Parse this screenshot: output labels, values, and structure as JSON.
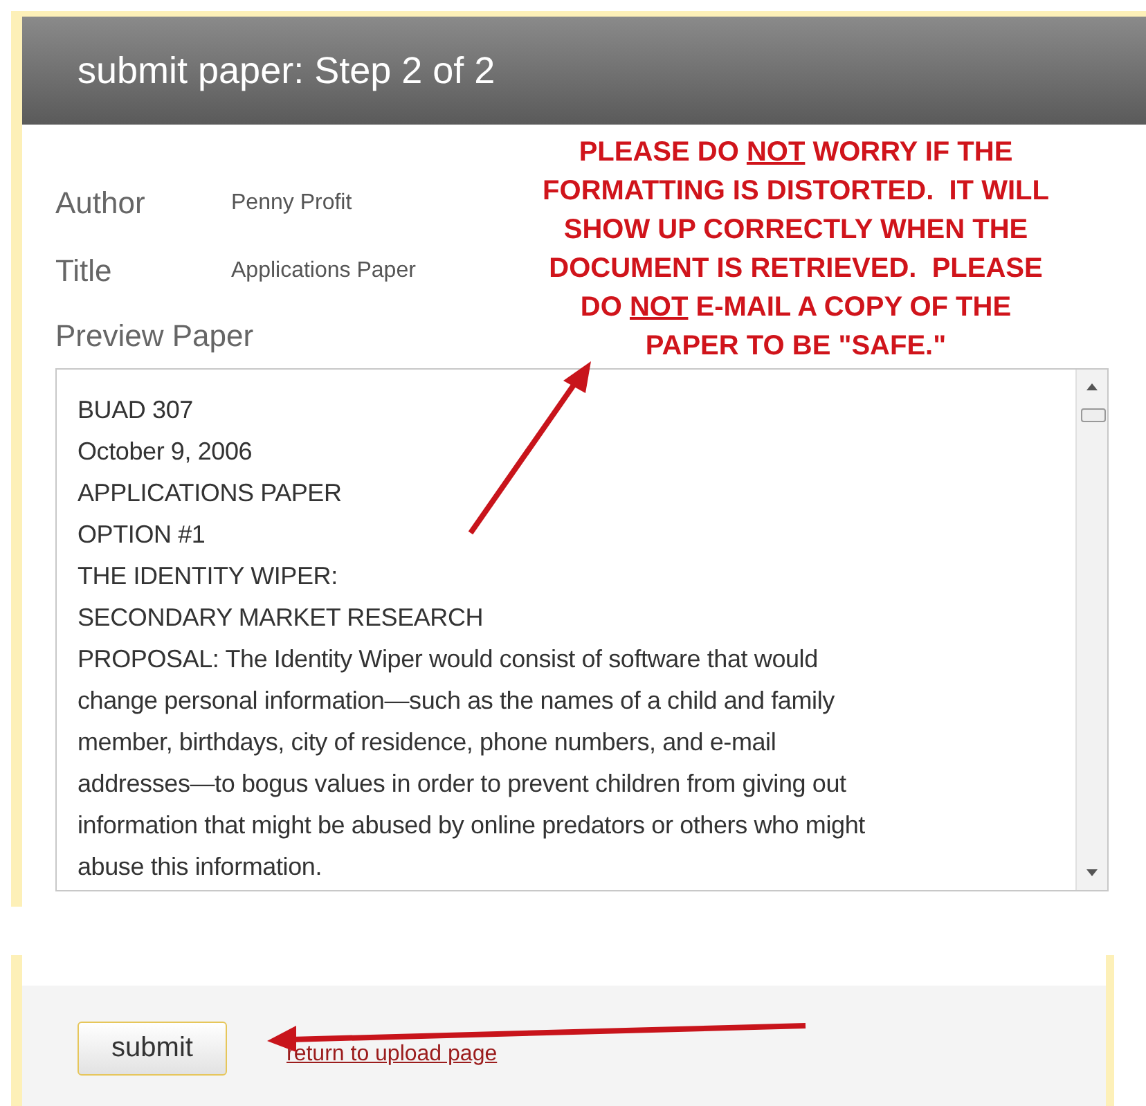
{
  "header": {
    "title": "submit paper: Step 2 of 2"
  },
  "fields": [
    {
      "label": "Author",
      "value": "Penny Profit"
    },
    {
      "label": "Title",
      "value": "Applications Paper"
    }
  ],
  "preview": {
    "label": "Preview Paper",
    "lines": [
      "BUAD 307",
      "October 9, 2006",
      "APPLICATIONS PAPER",
      "OPTION #1",
      "THE IDENTITY WIPER:",
      "SECONDARY MARKET RESEARCH",
      "PROPOSAL: The Identity Wiper would consist of software that would",
      "change personal information—such as the names of a child and family",
      "member, birthdays, city of residence, phone numbers, and e-mail",
      "addresses—to bogus values in order to prevent children from giving out",
      "information that might be abused by online predators or others who might",
      "abuse this information."
    ]
  },
  "annotation": {
    "lines": [
      [
        {
          "text": "PLEASE DO ",
          "underlined": false
        },
        {
          "text": "NOT",
          "underlined": true
        },
        {
          "text": " WORRY IF THE",
          "underlined": false
        }
      ],
      [
        {
          "text": "FORMATTING IS DISTORTED.  IT WILL",
          "underlined": false
        }
      ],
      [
        {
          "text": "SHOW UP CORRECTLY WHEN THE",
          "underlined": false
        }
      ],
      [
        {
          "text": "DOCUMENT IS RETRIEVED.  PLEASE",
          "underlined": false
        }
      ],
      [
        {
          "text": "DO ",
          "underlined": false
        },
        {
          "text": "NOT",
          "underlined": true
        },
        {
          "text": " E-MAIL A COPY OF THE",
          "underlined": false
        }
      ],
      [
        {
          "text": "PAPER TO BE \"SAFE.\"",
          "underlined": false
        }
      ]
    ]
  },
  "footer": {
    "button": "submit",
    "link": "return to upload page"
  }
}
